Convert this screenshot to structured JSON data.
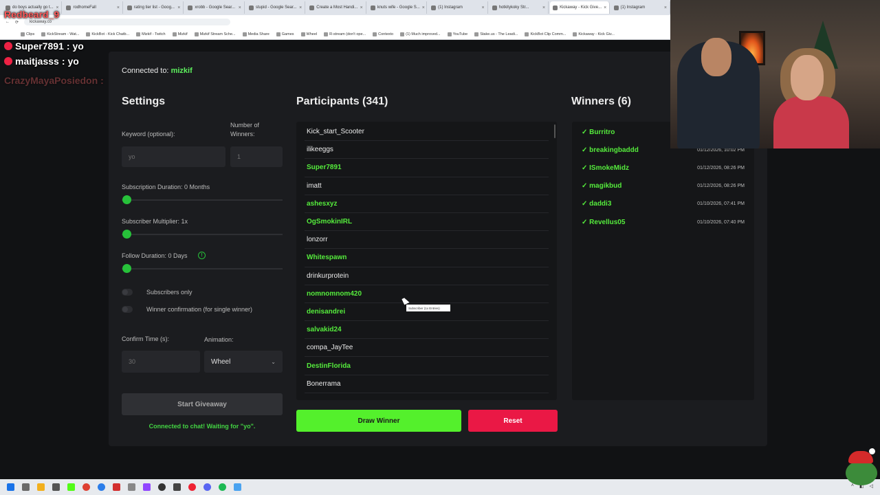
{
  "browser": {
    "tabs": [
      {
        "label": "do boys actually go t..."
      },
      {
        "label": "rodhomeFall"
      },
      {
        "label": "rating tier list - Goog..."
      },
      {
        "label": "xrobb - Google Sear..."
      },
      {
        "label": "stupid - Google Sear..."
      },
      {
        "label": "Create a Most Handi..."
      },
      {
        "label": "knuts wife - Google S..."
      },
      {
        "label": "(1) Instagram"
      },
      {
        "label": "hotkitykoky Str..."
      },
      {
        "label": "Kickaway - Kick Give..."
      },
      {
        "label": "(1) Instagram"
      }
    ],
    "url": "kickaway.co",
    "bookmarks": [
      "Clips",
      "KickStream - Wat...",
      "KickBot - Kick Chatb...",
      "Mizkif - Twitch",
      "Mizkif",
      "Mizkif Stream Sche...",
      "Media Share",
      "Games",
      "Wheel",
      "R-stream (don't ope...",
      "Contexto",
      "(1) Much improved...",
      "YouTube",
      "Stake.us - The Leadi...",
      "KickBot Clip Comm...",
      "Kickaway - Kick Giv..."
    ]
  },
  "chat_overlay": [
    {
      "user": "Redbeard_9",
      "message": ""
    },
    {
      "user": "Super7891",
      "message": "yo"
    },
    {
      "user": "maitjasss",
      "message": "yo"
    },
    {
      "user": "CrazyMayaPosiedon",
      "message": ""
    }
  ],
  "app": {
    "connected_label": "Connected to:",
    "channel": "mizkif",
    "settings": {
      "title": "Settings",
      "keyword_label": "Keyword (optional):",
      "keyword_value": "yo",
      "winners_label": "Number of Winners:",
      "winners_value": "1",
      "sub_duration_label": "Subscription Duration: 0 Months",
      "sub_multiplier_label": "Subscriber Multiplier: 1x",
      "follow_duration_label": "Follow Duration: 0 Days",
      "subscribers_only_label": "Subscribers only",
      "winner_confirm_label": "Winner confirmation (for single winner)",
      "confirm_time_label": "Confirm Time (s):",
      "confirm_time_value": "30",
      "animation_label": "Animation:",
      "animation_value": "Wheel",
      "start_button": "Start Giveaway",
      "status": "Connected to chat! Waiting for \"yo\"."
    },
    "participants": {
      "title": "Participants (341)",
      "items": [
        {
          "name": "Kick_start_Scooter",
          "sub": false
        },
        {
          "name": "ilikeeggs",
          "sub": false
        },
        {
          "name": "Super7891",
          "sub": true
        },
        {
          "name": "imatt",
          "sub": false
        },
        {
          "name": "ashesxyz",
          "sub": true
        },
        {
          "name": "OgSmokinIRL",
          "sub": true
        },
        {
          "name": "lonzorr",
          "sub": false
        },
        {
          "name": "Whitespawn",
          "sub": true
        },
        {
          "name": "drinkurprotein",
          "sub": false
        },
        {
          "name": "nomnomnom420",
          "sub": true
        },
        {
          "name": "denisandrei",
          "sub": true
        },
        {
          "name": "salvakid24",
          "sub": true
        },
        {
          "name": "compa_JayTee",
          "sub": false
        },
        {
          "name": "DestinFlorida",
          "sub": true
        },
        {
          "name": "Bonerrama",
          "sub": false
        }
      ],
      "tooltip": "Subscriber (1x Entries)"
    },
    "winners": {
      "title": "Winners (6)",
      "items": [
        {
          "name": "✓ Burritro",
          "time": ""
        },
        {
          "name": "✓ breakingbaddd",
          "time": "01/12/2026, 10:02 PM"
        },
        {
          "name": "✓ ISmokeMidz",
          "time": "01/12/2026, 08:26 PM"
        },
        {
          "name": "✓ magikbud",
          "time": "01/12/2026, 08:26 PM"
        },
        {
          "name": "✓ daddi3",
          "time": "01/10/2026, 07:41 PM"
        },
        {
          "name": "✓ Revellus05",
          "time": "01/10/2026, 07:40 PM"
        }
      ]
    },
    "draw_button": "Draw Winner",
    "reset_button": "Reset"
  },
  "colors": {
    "accent_green": "#54f02c",
    "sub_green": "#55ec3c",
    "reset_red": "#ea1845",
    "panel": "#1b1c1f"
  }
}
